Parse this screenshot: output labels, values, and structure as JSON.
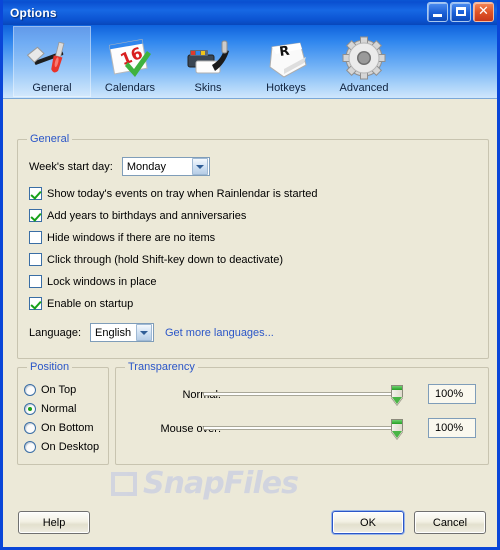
{
  "window": {
    "title": "Options",
    "controls": {
      "minimize": "minimize",
      "maximize": "maximize",
      "close": "✕"
    }
  },
  "tabs": [
    {
      "label": "General",
      "icon": "hammer-screwdriver-icon",
      "selected": true
    },
    {
      "label": "Calendars",
      "icon": "calendar-check-icon",
      "selected": false
    },
    {
      "label": "Skins",
      "icon": "paint-roller-icon",
      "selected": false
    },
    {
      "label": "Hotkeys",
      "icon": "keyboard-key-icon",
      "selected": false
    },
    {
      "label": "Advanced",
      "icon": "gear-icon",
      "selected": false
    }
  ],
  "general": {
    "group_title": "General",
    "week_start_label": "Week's start day:",
    "week_start_value": "Monday",
    "checkboxes": [
      {
        "label": "Show today's events on tray when Rainlendar is started",
        "checked": true
      },
      {
        "label": "Add years to birthdays and anniversaries",
        "checked": true
      },
      {
        "label": "Hide windows if there are no items",
        "checked": false
      },
      {
        "label": "Click through (hold Shift-key down to deactivate)",
        "checked": false
      },
      {
        "label": "Lock windows in place",
        "checked": false
      },
      {
        "label": "Enable on startup",
        "checked": true
      }
    ],
    "language_label": "Language:",
    "language_value": "English",
    "language_link": "Get more languages..."
  },
  "position": {
    "group_title": "Position",
    "options": [
      {
        "label": "On Top",
        "selected": false
      },
      {
        "label": "Normal",
        "selected": true
      },
      {
        "label": "On Bottom",
        "selected": false
      },
      {
        "label": "On Desktop",
        "selected": false
      }
    ]
  },
  "transparency": {
    "group_title": "Transparency",
    "rows": [
      {
        "label": "Normal:",
        "value": "100%",
        "slider_percent": 100
      },
      {
        "label": "Mouse over:",
        "value": "100%",
        "slider_percent": 100
      }
    ]
  },
  "watermark": {
    "text": "SnapFiles"
  },
  "footer": {
    "help": "Help",
    "ok": "OK",
    "cancel": "Cancel"
  },
  "colors": {
    "dialog_bg": "#ece9d8",
    "title_blue": "#0a4fd0",
    "group_title": "#2b56c8",
    "link": "#2b56c8",
    "check_green": "#16a018",
    "border_blue": "#7f9db9"
  }
}
